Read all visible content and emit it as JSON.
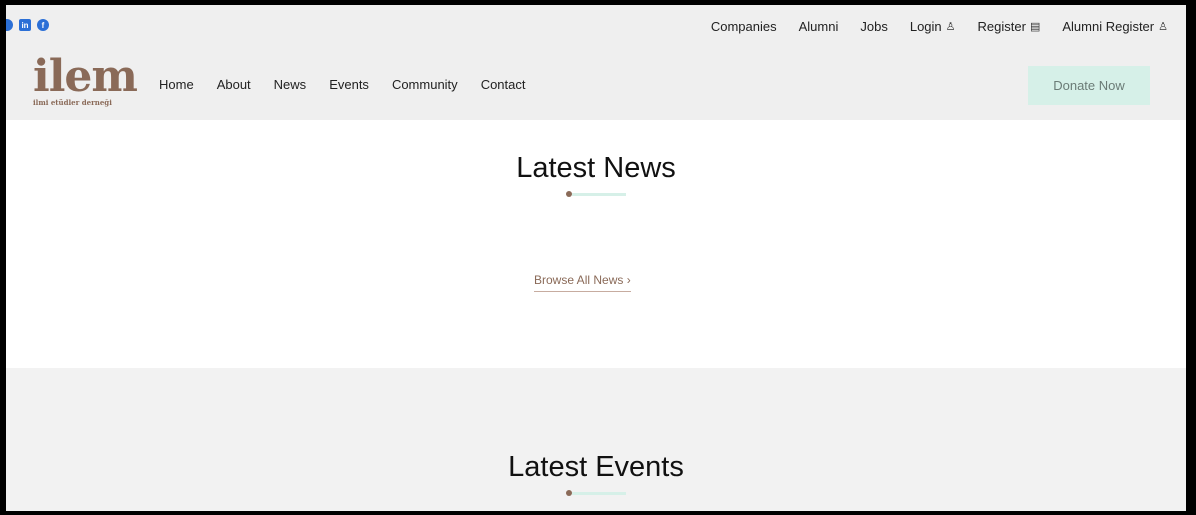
{
  "social": [
    {
      "icon": "instagram-icon",
      "glyph": ""
    },
    {
      "icon": "linkedin-icon",
      "glyph": "in"
    },
    {
      "icon": "facebook-icon",
      "glyph": "f"
    }
  ],
  "topbar": {
    "companies": "Companies",
    "alumni": "Alumni",
    "jobs": "Jobs",
    "login": "Login",
    "register": "Register",
    "alumni_register": "Alumni Register"
  },
  "logo": {
    "word": "ilem",
    "sub": "ilmi etüdler derneği"
  },
  "nav": {
    "home": "Home",
    "about": "About",
    "news": "News",
    "events": "Events",
    "community": "Community",
    "contact": "Contact"
  },
  "donate_label": "Donate Now",
  "news_section": {
    "title": "Latest News",
    "browse_label": "Browse All News  ›"
  },
  "events_section": {
    "title": "Latest Events"
  },
  "colors": {
    "brand": "#8a6a58",
    "accent_mint": "#d6f0e8",
    "social_blue": "#2b6fd6"
  }
}
